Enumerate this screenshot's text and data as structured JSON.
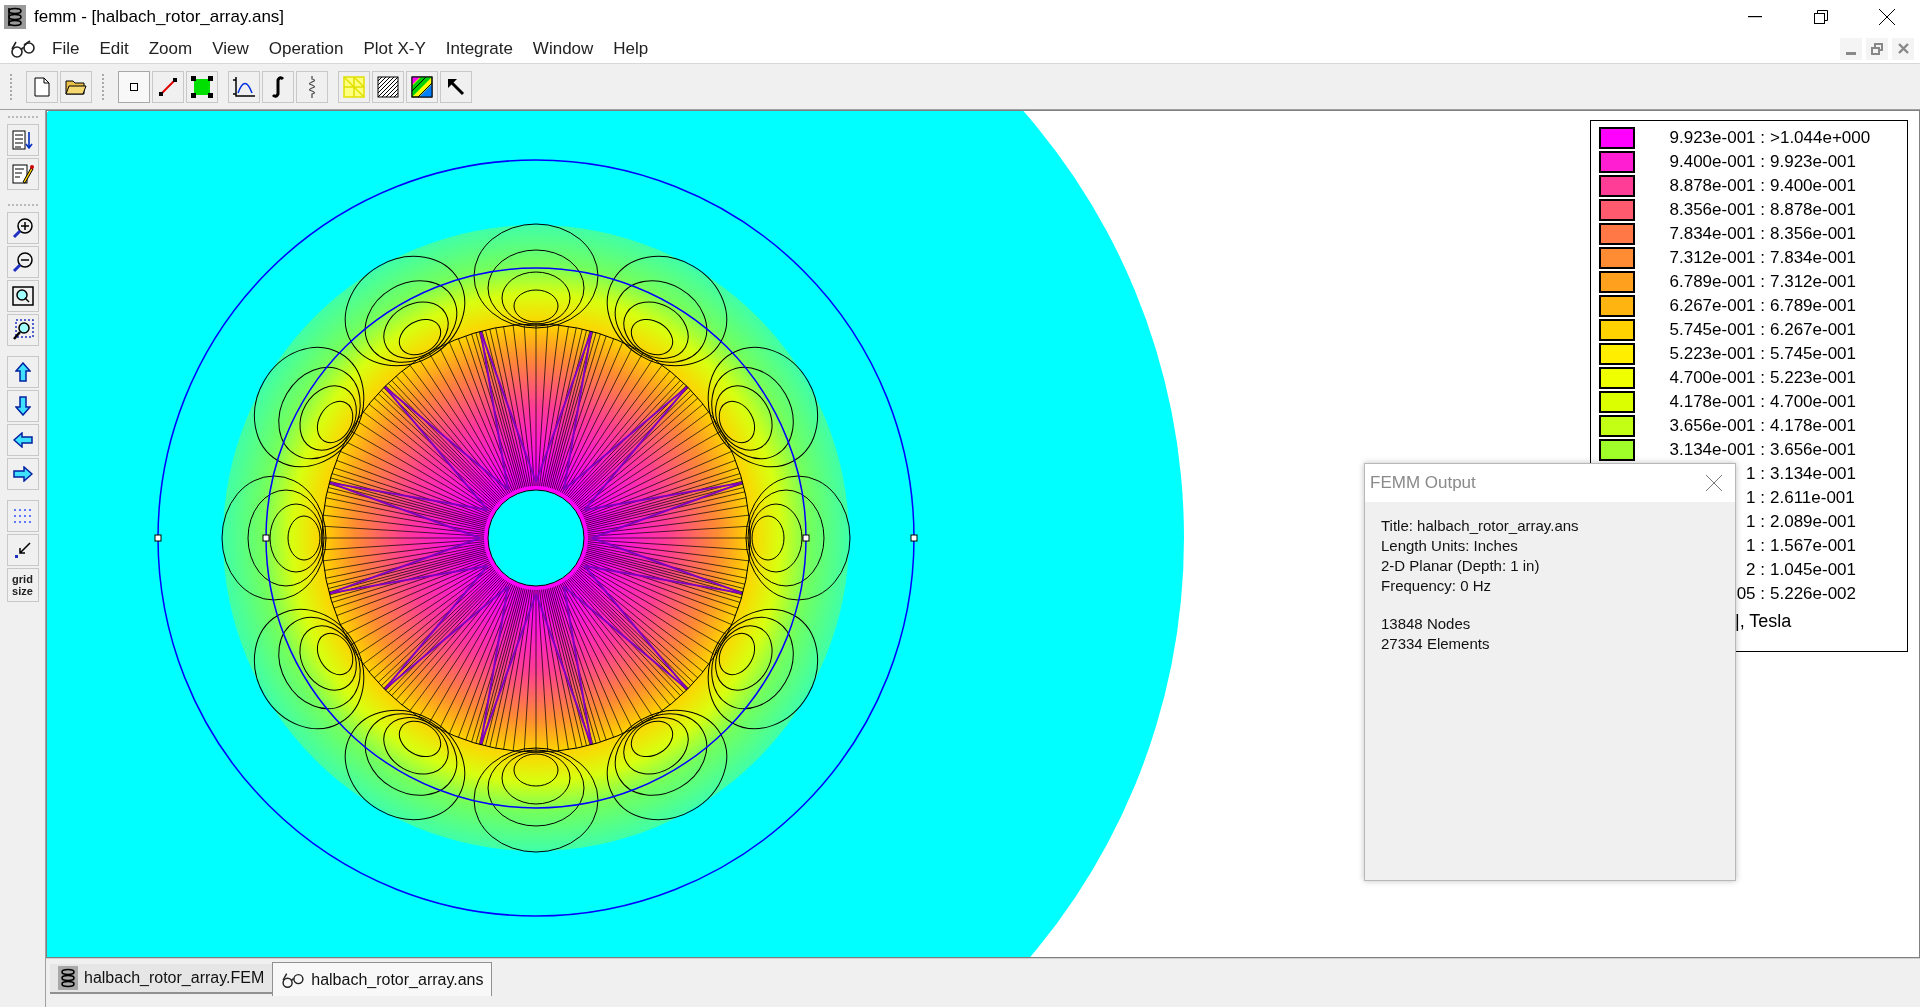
{
  "window": {
    "title": "femm - [halbach_rotor_array.ans]"
  },
  "menu": [
    "File",
    "Edit",
    "Zoom",
    "View",
    "Operation",
    "Plot X-Y",
    "Integrate",
    "Window",
    "Help"
  ],
  "side_toolbar": {
    "grid_button": "grid size"
  },
  "legend": {
    "rows": [
      {
        "low": "9.923e-001 :",
        "high": ">1.044e+000",
        "color": "#ff00ff"
      },
      {
        "low": "9.400e-001 :",
        "high": "9.923e-001",
        "color": "#ff1ed2"
      },
      {
        "low": "8.878e-001 :",
        "high": "9.400e-001",
        "color": "#ff3c96"
      },
      {
        "low": "8.356e-001 :",
        "high": "8.878e-001",
        "color": "#ff5a6e"
      },
      {
        "low": "7.834e-001 :",
        "high": "8.356e-001",
        "color": "#ff7846"
      },
      {
        "low": "7.312e-001 :",
        "high": "7.834e-001",
        "color": "#ff8c32"
      },
      {
        "low": "6.789e-001 :",
        "high": "7.312e-001",
        "color": "#ffa01e"
      },
      {
        "low": "6.267e-001 :",
        "high": "6.789e-001",
        "color": "#ffb40f"
      },
      {
        "low": "5.745e-001 :",
        "high": "6.267e-001",
        "color": "#ffd200"
      },
      {
        "low": "5.223e-001 :",
        "high": "5.745e-001",
        "color": "#ffee00"
      },
      {
        "low": "4.700e-001 :",
        "high": "5.223e-001",
        "color": "#f0ff00"
      },
      {
        "low": "4.178e-001 :",
        "high": "4.700e-001",
        "color": "#dcff00"
      },
      {
        "low": "3.656e-001 :",
        "high": "4.178e-001",
        "color": "#c3ff14"
      },
      {
        "low": "3.134e-001 :",
        "high": "3.656e-001",
        "color": "#a0ff28"
      },
      {
        "low": "1 :",
        "high": "3.134e-001"
      },
      {
        "low": "1 :",
        "high": "2.611e-001"
      },
      {
        "low": "1 :",
        "high": "2.089e-001"
      },
      {
        "low": "1 :",
        "high": "1.567e-001"
      },
      {
        "low": "2 :",
        "high": "1.045e-001"
      },
      {
        "low": "05 :",
        "high": "5.226e-002"
      }
    ],
    "units": "|, Tesla"
  },
  "output_window": {
    "title": "FEMM Output",
    "lines": [
      "Title: halbach_rotor_array.ans",
      "Length Units: Inches",
      "2-D Planar (Depth: 1 in)",
      "Frequency: 0 Hz"
    ],
    "stats": [
      "13848 Nodes",
      "27334 Elements"
    ]
  },
  "tabs": [
    {
      "label": "halbach_rotor_array.FEM",
      "kind": "fem",
      "selected": false
    },
    {
      "label": "halbach_rotor_array.ans",
      "kind": "ans",
      "selected": true
    }
  ]
}
